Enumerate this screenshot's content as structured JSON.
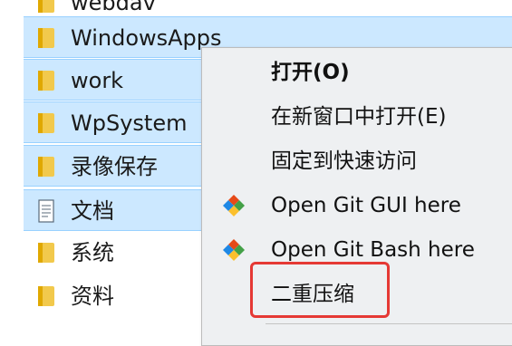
{
  "files": [
    {
      "name": "webdav",
      "icon": "folder-icon",
      "selected": false
    },
    {
      "name": "WindowsApps",
      "icon": "folder-icon",
      "selected": true
    },
    {
      "name": "work",
      "icon": "folder-icon",
      "selected": true
    },
    {
      "name": "WpSystem",
      "icon": "folder-icon",
      "selected": true
    },
    {
      "name": "录像保存",
      "icon": "folder-icon",
      "selected": true
    },
    {
      "name": "文档",
      "icon": "document-icon",
      "selected": true
    },
    {
      "name": "系统",
      "icon": "folder-icon",
      "selected": false
    },
    {
      "name": "资料",
      "icon": "folder-icon",
      "selected": false
    }
  ],
  "context_menu": {
    "items": [
      {
        "label": "打开(O)",
        "bold": true,
        "icon": ""
      },
      {
        "label": "在新窗口中打开(E)",
        "bold": false,
        "icon": ""
      },
      {
        "label": "固定到快速访问",
        "bold": false,
        "icon": ""
      },
      {
        "label": "Open Git GUI here",
        "bold": false,
        "icon": "git-icon"
      },
      {
        "label": "Open Git Bash here",
        "bold": false,
        "icon": "git-icon"
      },
      {
        "label": "二重压缩",
        "bold": false,
        "icon": ""
      }
    ]
  },
  "colors": {
    "selection_bg": "#cce8ff",
    "folder_yellow": "#f2c94c",
    "highlight_red": "#e53935"
  }
}
